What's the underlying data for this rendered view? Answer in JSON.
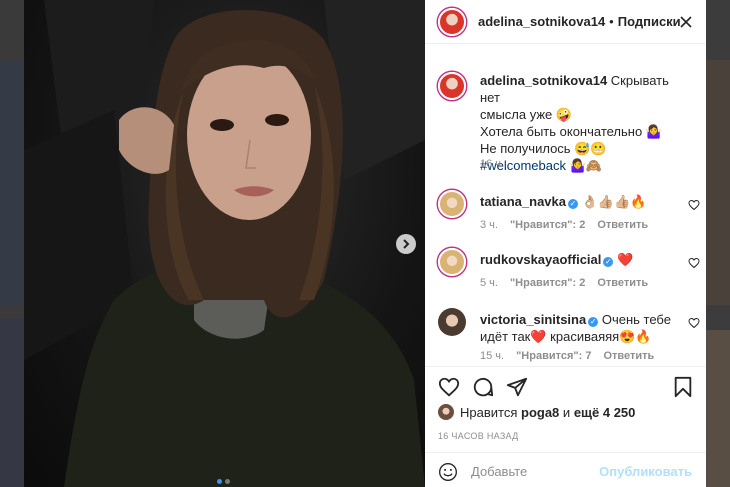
{
  "post": {
    "author": "adelina_sotnikova14",
    "separator": "•",
    "follow_label": "Подписки",
    "caption_line1": "Скрывать нет",
    "caption_line2": "смысла уже 🤪",
    "caption_line3": "Хотела быть окончательно 🤷‍♀️",
    "caption_line4": "Не получилось 😅😬",
    "caption_hashtag": "#welcomeback",
    "caption_hashtag_emoji": "🤷‍♀️🙈",
    "caption_time": "16 ч.",
    "carousel": {
      "current": 1,
      "total": 2
    }
  },
  "comments": [
    {
      "user": "tatiana_navka",
      "text": "👌🏼👍🏼👍🏼🔥",
      "time": "3 ч.",
      "likes": "\"Нравится\": 2",
      "reply": "Ответить",
      "avatar": "blond"
    },
    {
      "user": "rudkovskayaofficial",
      "text": "❤️",
      "time": "5 ч.",
      "likes": "\"Нравится\": 2",
      "reply": "Ответить",
      "avatar": "blond"
    },
    {
      "user": "victoria_sinitsina",
      "text": "Очень тебе",
      "text2": "идёт так❤️ красиваяяя😍🔥",
      "time": "15 ч.",
      "likes": "\"Нравится\": 7",
      "reply": "Ответить",
      "avatar": "dark"
    }
  ],
  "likes": {
    "prefix": "Нравится",
    "user": "poga8",
    "middle": "и",
    "others": "ещё 4 250"
  },
  "timestamp": "16 ЧАСОВ НАЗАД",
  "add_comment": {
    "placeholder": "Добавьте",
    "publish_label": "Опубликовать"
  },
  "icons": [
    "more-icon",
    "next-arrow-icon",
    "heart-icon",
    "comment-icon",
    "share-icon",
    "bookmark-icon",
    "emoji-icon"
  ],
  "colors": {
    "accent": "#3897f0",
    "publish_disabled": "#b2dffc",
    "hashtag": "#00376b",
    "meta": "#8e8e8e"
  }
}
